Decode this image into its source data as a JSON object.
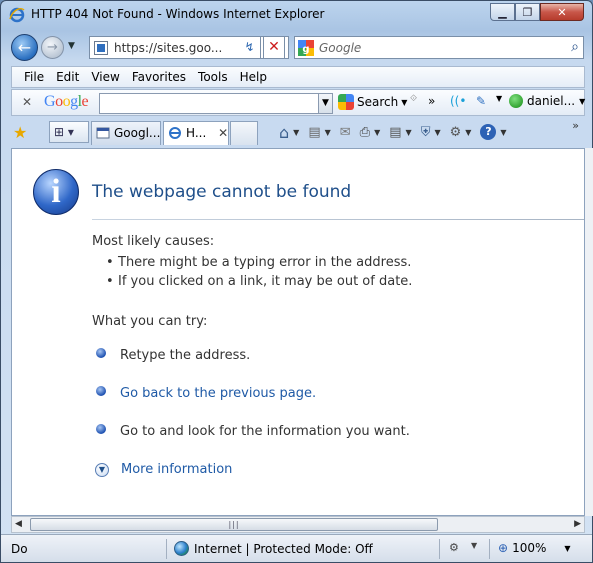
{
  "window": {
    "title": "HTTP 404 Not Found - Windows Internet Explorer",
    "minimize": "▁",
    "maximize": "❐",
    "close": "✕"
  },
  "navigation": {
    "back": "←",
    "forward": "→",
    "history_dropdown": "▼",
    "address": "https://sites.goo...",
    "refresh": "↯",
    "stop": "✕",
    "search_placeholder": "Google",
    "search_go": "⌕"
  },
  "menu": {
    "items": [
      "File",
      "Edit",
      "View",
      "Favorites",
      "Tools",
      "Help"
    ]
  },
  "google_toolbar": {
    "close": "✕",
    "logo": "Google",
    "search_label": "Search",
    "more": "»",
    "account": "daniel..."
  },
  "tabs": {
    "quick_tabs": "⊞ ▾",
    "items": [
      {
        "label": "Googl...",
        "active": false
      },
      {
        "label": "H...",
        "active": true,
        "close": "✕"
      }
    ]
  },
  "command_bar": {
    "home": "⌂",
    "feeds": "▤",
    "read_mail": "✉",
    "print": "⎙",
    "page": "▤",
    "safety": "⛨",
    "tools": "⚙",
    "help": "?",
    "more": "»"
  },
  "page": {
    "title": "The webpage cannot be found",
    "causes_heading": "Most likely causes:",
    "causes": [
      "There might be a typing error in the address.",
      "If you clicked on a link, it may be out of date."
    ],
    "try_heading": "What you can try:",
    "try_items": [
      {
        "text": "Retype the address.",
        "is_link": false
      },
      {
        "text": "Go back to the previous page.",
        "is_link": true
      },
      {
        "text": "Go to  and look for the information you want.",
        "is_link": false
      }
    ],
    "more_info": "More information"
  },
  "status": {
    "text": "Do",
    "zone": "Internet | Protected Mode: Off",
    "zoom": "100%"
  },
  "colors": {
    "accent": "#1f5aa6",
    "title_blue": "#1f4f8a"
  }
}
